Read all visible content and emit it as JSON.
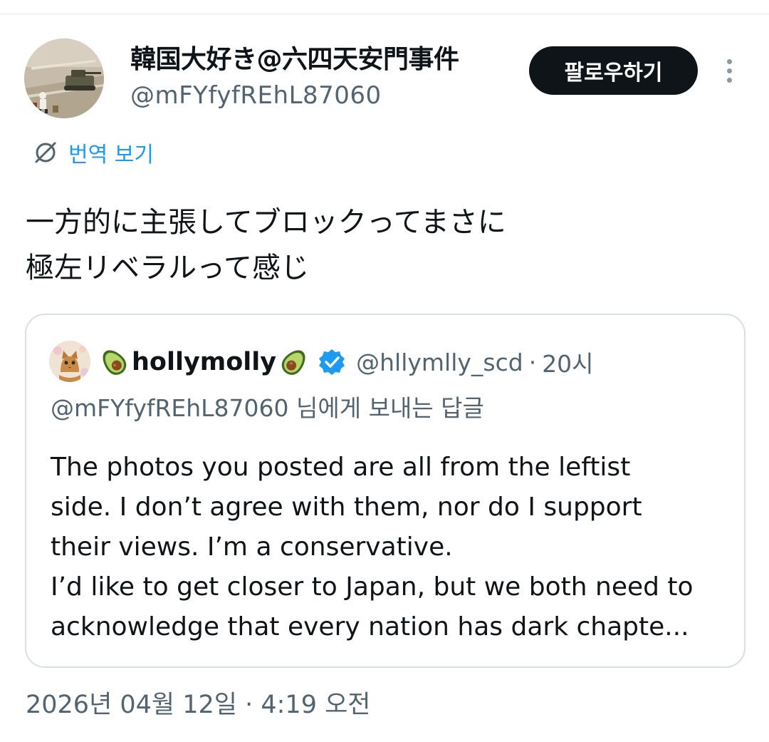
{
  "tweet": {
    "display_name": "韓国大好き@六四天安門事件",
    "handle": "@mFYfyfREhL87060",
    "follow_label": "팔로우하기",
    "translate_label": "번역 보기",
    "text": "一方的に主張してブロックってまさに\n極左リベラルって感じ",
    "timestamp": "2026년 04월 12일 · 4:19 오전"
  },
  "quote": {
    "name": "hollymolly",
    "handle": "@hllymlly_scd",
    "separator": "·",
    "time": "20시",
    "reply_to": "@mFYfyfREhL87060 님에게 보내는 답글",
    "lines": [
      "The photos you posted are all from the leftist",
      "side. I don’t agree with them, nor do I support",
      "their views. I’m a conservative.",
      "I’d like to get closer to Japan, but we both need to",
      "acknowledge that every nation has dark chapte..."
    ]
  },
  "colors": {
    "text": "#0f1419",
    "secondary": "#536471",
    "link": "#1d9bf0",
    "border": "#d9dfe4",
    "button_bg": "#0f1419",
    "verified": "#1d9bf0"
  },
  "icons": [
    "more-icon",
    "translate-icon",
    "avocado-emoji",
    "verified-badge-icon"
  ]
}
